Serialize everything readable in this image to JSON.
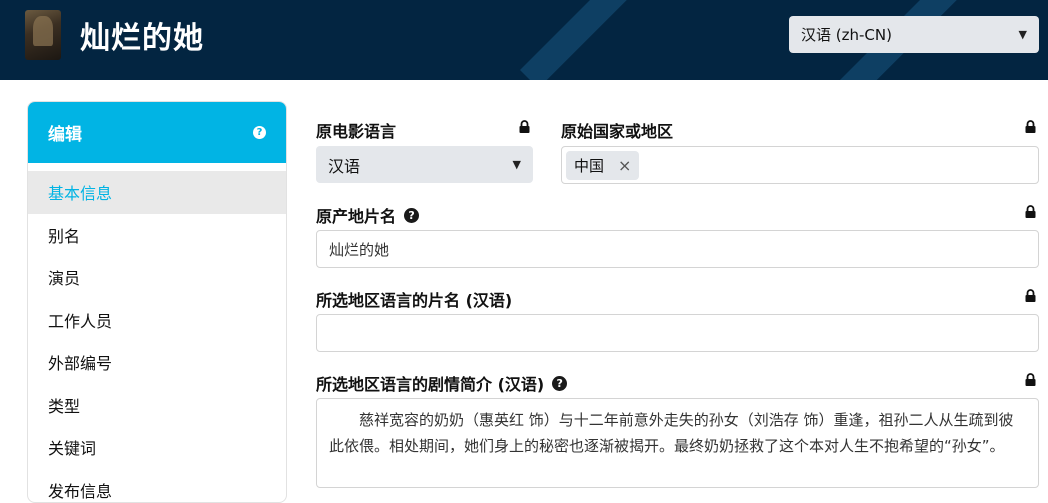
{
  "header": {
    "title": "灿烂的她",
    "language_selector": "汉语 (zh-CN)"
  },
  "sidebar": {
    "heading": "编辑",
    "help_symbol": "?",
    "items": [
      {
        "label": "基本信息"
      },
      {
        "label": "别名"
      },
      {
        "label": "演员"
      },
      {
        "label": "工作人员"
      },
      {
        "label": "外部编号"
      },
      {
        "label": "类型"
      },
      {
        "label": "关键词"
      },
      {
        "label": "发布信息"
      }
    ]
  },
  "form": {
    "original_language_label": "原电影语言",
    "original_language_value": "汉语",
    "origin_country_label": "原始国家或地区",
    "origin_country_tag": "中国",
    "remove_symbol": "×",
    "original_title_label": "原产地片名",
    "original_title_value": "灿烂的她",
    "translated_title_label": "所选地区语言的片名 (汉语)",
    "translated_title_value": "",
    "overview_label": "所选地区语言的剧情简介 (汉语)",
    "overview_value": "慈祥宽容的奶奶（惠英红 饰）与十二年前意外走失的孙女（刘浩存 饰）重逢，祖孙二人从生疏到彼此依偎。相处期间，她们身上的秘密也逐渐被揭开。最终奶奶拯救了这个本对人生不抱希望的“孙女”。",
    "help_symbol": "?"
  },
  "colors": {
    "header_bg": "#032541",
    "accent": "#01b4e4",
    "select_bg": "#e4e7eb"
  },
  "icons": [
    "poster-thumbnail",
    "help-icon",
    "lock-icon",
    "dropdown-caret-icon",
    "remove-icon"
  ]
}
